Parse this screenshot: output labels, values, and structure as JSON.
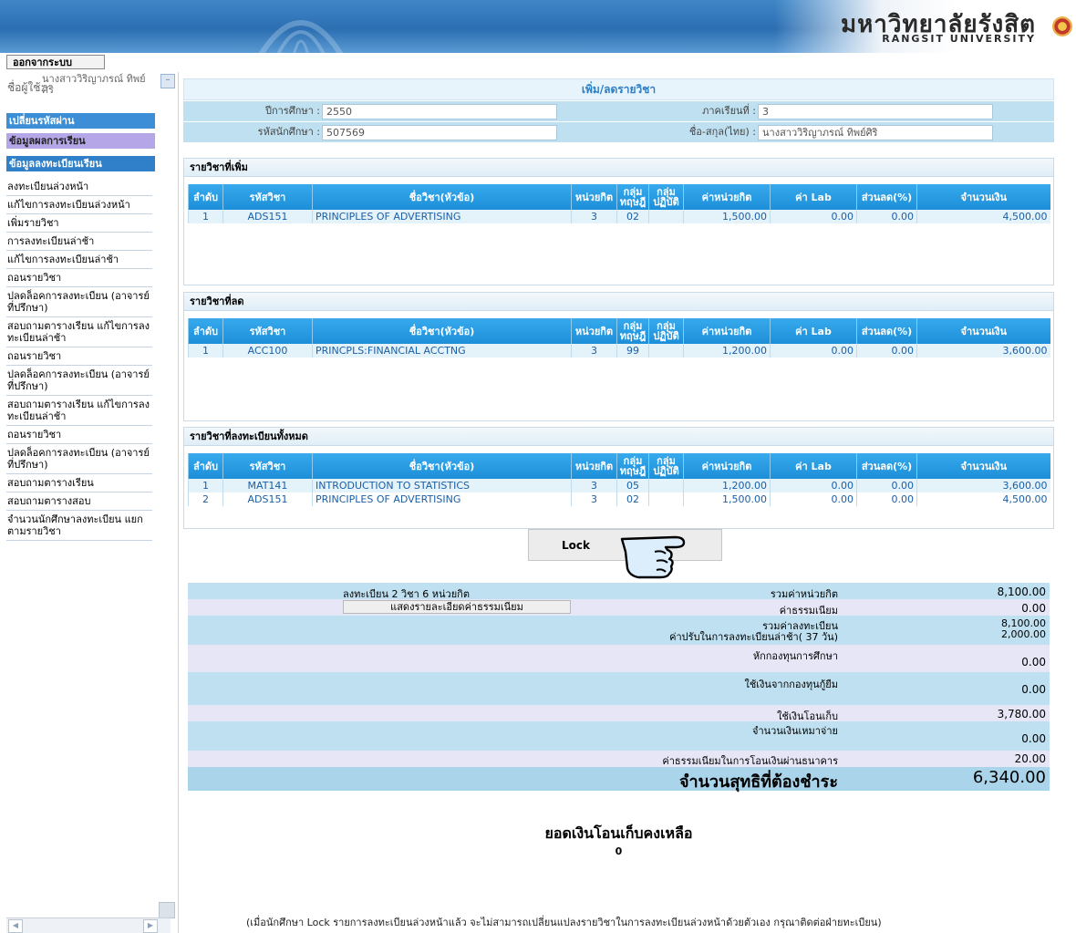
{
  "header": {
    "university_th": "มหาวิทยาลัยรังสิต",
    "university_en": "RANGSIT UNIVERSITY"
  },
  "sidebar": {
    "logout_label": "ออกจากระบบ",
    "user_label": "ชื่อผู้ใช้:",
    "user_name": "นางสาววิริญาภรณ์ ทิพย์ศิริ",
    "change_password": "เปลี่ยนรหัสผ่าน",
    "grades": "ข้อมูลผลการเรียน",
    "registration": "ข้อมูลลงทะเบียนเรียน",
    "menu_items": [
      "ลงทะเบียนล่วงหน้า",
      "แก้ไขการลงทะเบียนล่วงหน้า",
      "เพิ่มรายวิชา",
      "การลงทะเบียนล่าช้า",
      "แก้ไขการลงทะเบียนล่าช้า",
      "ถอนรายวิชา",
      "ปลดล็อคการลงทะเบียน (อาจารย์ที่ปรึกษา)",
      "สอบถามตารางเรียน แก้ไขการลงทะเบียนล่าช้า",
      "ถอนรายวิชา",
      "ปลดล็อคการลงทะเบียน (อาจารย์ที่ปรึกษา)",
      "สอบถามตารางเรียน แก้ไขการลงทะเบียนล่าช้า",
      "ถอนรายวิชา",
      "ปลดล็อคการลงทะเบียน (อาจารย์ที่ปรึกษา)",
      "สอบถามตารางเรียน",
      "สอบถามตารางสอบ",
      "จำนวนนักศึกษาลงทะเบียน แยกตามรายวิชา"
    ]
  },
  "page": {
    "title": "เพิ่ม/ลดรายวิชา",
    "academic_year_label": "ปีการศึกษา :",
    "academic_year": "2550",
    "semester_label": "ภาคเรียนที่ :",
    "semester": "3",
    "student_id_label": "รหัสนักศึกษา :",
    "student_id": "507569",
    "name_label": "ชื่อ-สกุล(ไทย) :",
    "name": "นางสาววิริญาภรณ์ ทิพย์ศิริ"
  },
  "columns": {
    "no": "ลำดับ",
    "code": "รหัสวิชา",
    "title": "ชื่อวิชา(หัวข้อ)",
    "credit": "หน่วยกิต",
    "lecture_group": "กลุ่ม ทฤษฎี",
    "lab_group": "กลุ่ม ปฏิบัติ",
    "credit_fee": "ค่าหน่วยกิต",
    "lab_fee": "ค่า Lab",
    "discount": "ส่วนลด(%)",
    "amount": "จำนวนเงิน"
  },
  "added": {
    "heading": "รายวิชาที่เพิ่ม",
    "rows": [
      {
        "no": "1",
        "code": "ADS151",
        "title": "PRINCIPLES OF ADVERTISING",
        "credit": "3",
        "lec": "02",
        "lab": "",
        "credit_fee": "1,500.00",
        "lab_fee": "0.00",
        "discount": "0.00",
        "amount": "4,500.00"
      }
    ]
  },
  "dropped": {
    "heading": "รายวิชาที่ลด",
    "rows": [
      {
        "no": "1",
        "code": "ACC100",
        "title": "PRINCPLS:FINANCIAL ACCTNG",
        "credit": "3",
        "lec": "99",
        "lab": "",
        "credit_fee": "1,200.00",
        "lab_fee": "0.00",
        "discount": "0.00",
        "amount": "3,600.00"
      }
    ]
  },
  "all": {
    "heading": "รายวิชาที่ลงทะเบียนทั้งหมด",
    "rows": [
      {
        "no": "1",
        "code": "MAT141",
        "title": "INTRODUCTION TO STATISTICS",
        "credit": "3",
        "lec": "05",
        "lab": "",
        "credit_fee": "1,200.00",
        "lab_fee": "0.00",
        "discount": "0.00",
        "amount": "3,600.00"
      },
      {
        "no": "2",
        "code": "ADS151",
        "title": "PRINCIPLES OF ADVERTISING",
        "credit": "3",
        "lec": "02",
        "lab": "",
        "credit_fee": "1,500.00",
        "lab_fee": "0.00",
        "discount": "0.00",
        "amount": "4,500.00"
      }
    ]
  },
  "lock_label": "Lock",
  "summary": {
    "reg_count": "ลงทะเบียน  2 วิชา 6 หน่วยกิต",
    "total_credit_fee_label": "รวมค่าหน่วยกิต",
    "total_credit_fee": "8,100.00",
    "show_fee_detail": "แสดงรายละเอียดค่าธรรมเนียม",
    "fee_label": "ค่าธรรมเนียม",
    "fee": "0.00",
    "total_reg_label": "รวมค่าลงทะเบียน",
    "total_reg": "8,100.00",
    "late_fine_label": "ค่าปรับในการลงทะเบียนล่าช้า( 37 วัน)",
    "late_fine": "2,000.00",
    "scholarship_label": "หักกองทุนการศึกษา",
    "scholarship": "0.00",
    "loan_label": "ใช้เงินจากกองทุนกู้ยืม",
    "loan": "0.00",
    "transfer_label": "ใช้เงินโอนเก็บ",
    "transfer": "3,780.00",
    "lump_label": "จำนวนเงินเหมาจ่าย",
    "lump": "0.00",
    "bank_fee_label": "ค่าธรรมเนียมในการโอนเงินผ่านธนาคาร",
    "bank_fee": "20.00",
    "net_label": "จำนวนสุทธิที่ต้องชำระ",
    "net": "6,340.00"
  },
  "balance": {
    "label": "ยอดเงินโอนเก็บคงเหลือ",
    "value": "0"
  },
  "note": "(เมื่อนักศึกษา Lock รายการลงทะเบียนล่วงหน้าแล้ว จะไม่สามารถเปลี่ยนแปลงรายวิชาในการลงทะเบียนล่วงหน้าด้วยตัวเอง กรุณาติดต่อฝ่ายทะเบียน)",
  "colors": {
    "header_blue": "#2c6fb2",
    "table_head": "#1d8fd9",
    "cell_text": "#1a5fa8",
    "summary_blue": "#bfe0f0",
    "summary_lav": "#e7e6f6"
  }
}
